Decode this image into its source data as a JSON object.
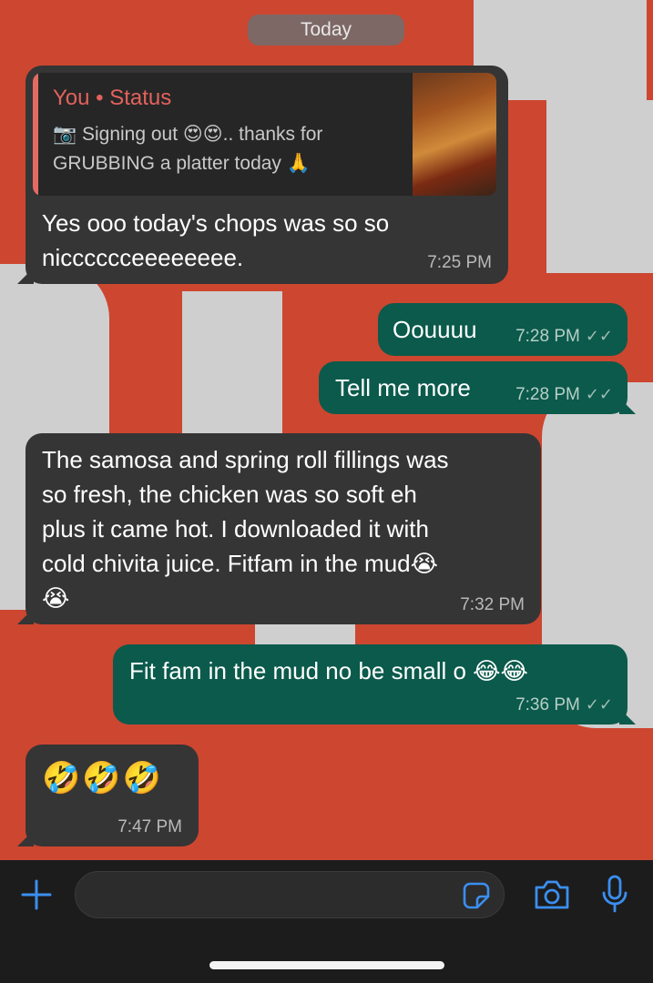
{
  "chat": {
    "date_divider": "Today",
    "messages": [
      {
        "direction": "incoming",
        "reply": {
          "title": "You • Status",
          "text": "📷 Signing out 😍😍.. thanks for GRUBBING a platter today 🙏"
        },
        "lines": [
          "Yes ooo today's chops was so so",
          "nicccccceeeeeeee."
        ],
        "time": "7:25 PM"
      },
      {
        "direction": "outgoing",
        "lines": [
          "Oouuuu"
        ],
        "time": "7:28 PM",
        "ticks": "✓✓"
      },
      {
        "direction": "outgoing",
        "lines": [
          "Tell me more"
        ],
        "time": "7:28 PM",
        "ticks": "✓✓"
      },
      {
        "direction": "incoming",
        "lines": [
          "The samosa and spring roll fillings was",
          "so fresh, the chicken was so soft eh",
          "plus it came hot. I downloaded it with",
          "cold chivita juice. Fitfam in the mud😭",
          "😭"
        ],
        "time": "7:32 PM"
      },
      {
        "direction": "outgoing",
        "lines": [
          "Fit fam in the mud no be small o 😂😂"
        ],
        "time": "7:36 PM",
        "ticks": "✓✓"
      },
      {
        "direction": "incoming",
        "lines": [
          "🤣🤣🤣"
        ],
        "time": "7:47 PM"
      }
    ]
  },
  "composer": {
    "icons": {
      "add": "plus-icon",
      "sticker": "sticker-icon",
      "camera": "camera-icon",
      "mic": "microphone-icon"
    },
    "input_placeholder": ""
  },
  "colors": {
    "wallpaper": "#cd4630",
    "incoming_bubble": "#353535",
    "outgoing_bubble": "#0b5a4b",
    "accent": "#3b8ff0",
    "status_title": "#e3625c"
  }
}
